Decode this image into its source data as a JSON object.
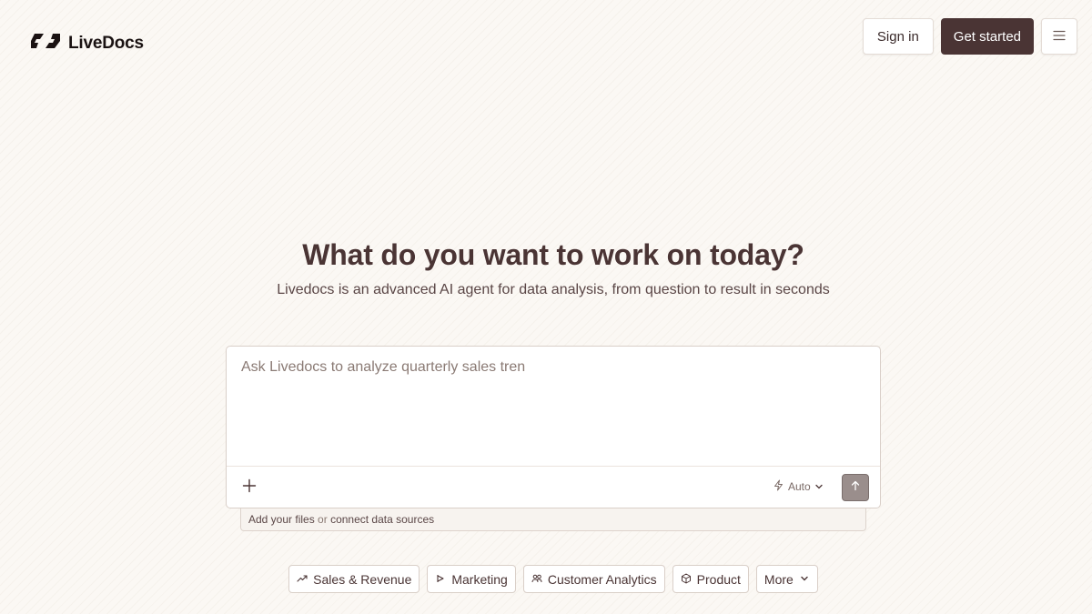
{
  "brand": {
    "name": "LiveDocs",
    "logo_icon": "livedocs-logo-icon"
  },
  "header": {
    "signin_label": "Sign in",
    "getstarted_label": "Get started",
    "menu_icon": "hamburger-menu-icon"
  },
  "hero": {
    "title": "What do you want to work on today?",
    "subtitle": "Livedocs is an advanced AI agent for data analysis, from question to result in seconds"
  },
  "prompt": {
    "placeholder": "Ask Livedocs to analyze quarterly sales tren",
    "value": "",
    "mode_label": "Auto",
    "add_icon": "plus-icon",
    "send_icon": "arrow-up-icon"
  },
  "file_bar": {
    "add_files": "Add your files",
    "or": "or",
    "connect": "connect data sources"
  },
  "chips": [
    {
      "label": "Sales & Revenue",
      "icon": "trend-up-icon"
    },
    {
      "label": "Marketing",
      "icon": "megaphone-icon"
    },
    {
      "label": "Customer Analytics",
      "icon": "users-icon"
    },
    {
      "label": "Product",
      "icon": "box-icon"
    }
  ],
  "more_chip": {
    "label": "More",
    "icon": "chevron-down-icon"
  },
  "colors": {
    "accent": "#4a3434",
    "background": "#fbf8f4",
    "border": "#d9cfc8"
  }
}
